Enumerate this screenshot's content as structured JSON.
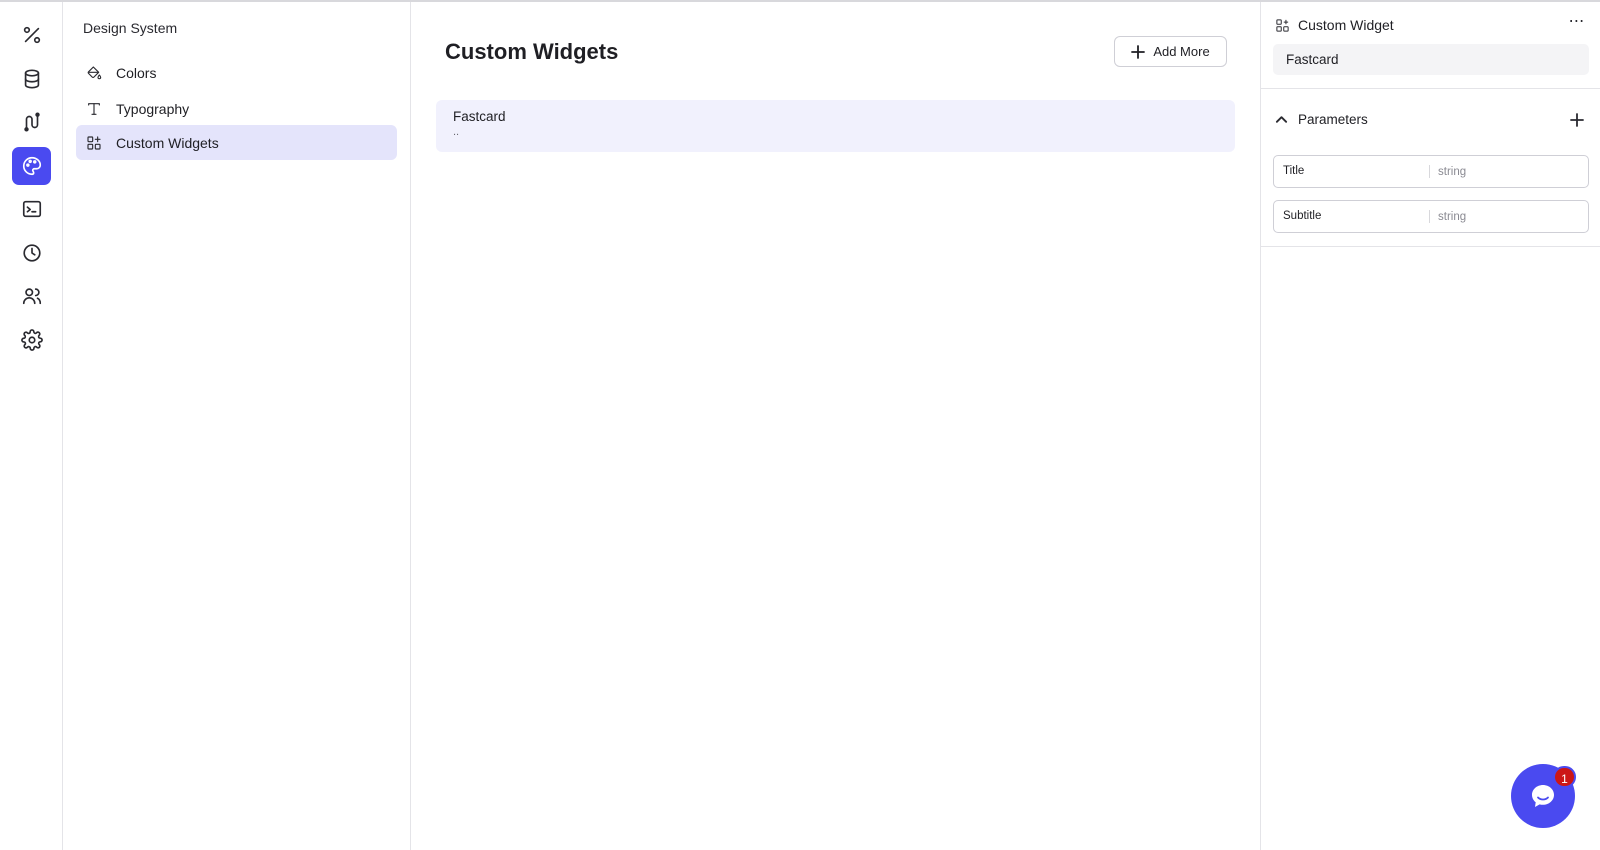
{
  "nav_rail": {
    "items": [
      {
        "icon": "percent-icon",
        "active": false
      },
      {
        "icon": "database-icon",
        "active": false
      },
      {
        "icon": "workflow-icon",
        "active": false
      },
      {
        "icon": "palette-icon",
        "active": true
      },
      {
        "icon": "terminal-icon",
        "active": false
      },
      {
        "icon": "clock-icon",
        "active": false
      },
      {
        "icon": "users-icon",
        "active": false
      },
      {
        "icon": "gear-icon",
        "active": false
      }
    ],
    "accent_color": "#4a4af0"
  },
  "design_system": {
    "title": "Design System",
    "items": [
      {
        "label": "Colors",
        "icon": "paint-bucket-icon",
        "active": false
      },
      {
        "label": "Typography",
        "icon": "text-icon",
        "active": false
      },
      {
        "label": "Custom Widgets",
        "icon": "widgets-icon",
        "active": true
      }
    ]
  },
  "main": {
    "title": "Custom Widgets",
    "add_label": "Add More",
    "widgets": [
      {
        "name": "Fastcard",
        "description": ".."
      }
    ]
  },
  "inspector": {
    "title": "Custom Widget",
    "widget_name": "Fastcard",
    "parameters_label": "Parameters",
    "parameters": [
      {
        "name": "Title",
        "type": "string"
      },
      {
        "name": "Subtitle",
        "type": "string"
      }
    ]
  },
  "chat": {
    "badge_count": "1"
  }
}
